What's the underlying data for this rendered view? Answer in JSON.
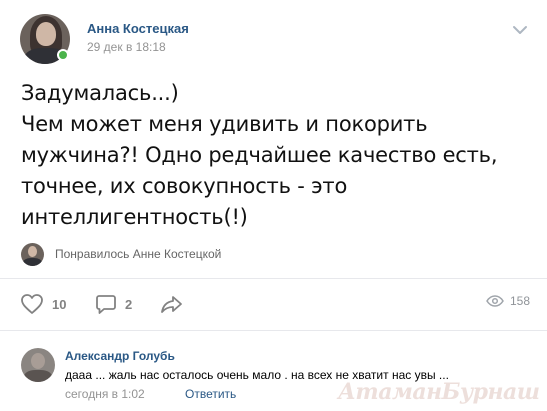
{
  "post": {
    "author_name": "Анна Костецкая",
    "date": "29 дек в 18:18",
    "text_lines": [
      "Задумалась...)",
      "Чем может меня удивить и покорить",
      "мужчина?! Одно редчайшее качество есть,",
      "точнее, их совокупность - это",
      "интеллигентность(!)"
    ],
    "liked_by": "Понравилось Анне Костецкой",
    "likes_count": "10",
    "comments_count": "2",
    "views_count": "158"
  },
  "comment": {
    "author_name": "Александр Голубь",
    "text": "дааа ... жаль нас осталось очень мало . на всех не хватит нас увы ...",
    "date": "сегодня в 1:02",
    "reply_label": "Ответить"
  },
  "watermark": "АтаманБурнаш для ЯП",
  "colors": {
    "link": "#2a5885",
    "muted": "#939393",
    "icon": "#828282",
    "online": "#4bb34b",
    "divider": "#e7e8ec"
  },
  "icons": {
    "like": "heart-outline-icon",
    "comment": "speech-bubble-icon",
    "share": "share-arrow-icon",
    "views": "eye-icon",
    "menu": "chevron-down-icon"
  }
}
